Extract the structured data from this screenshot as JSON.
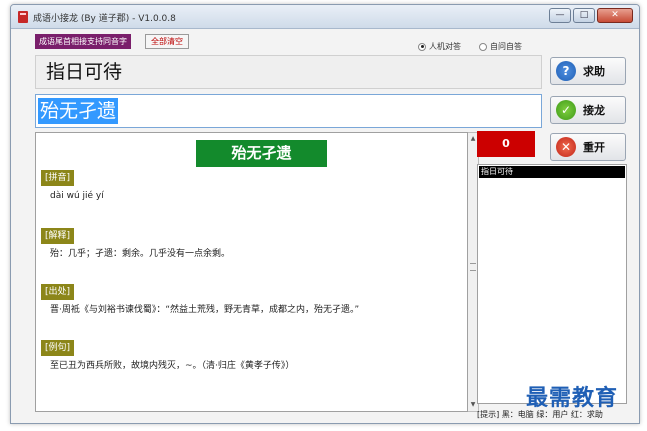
{
  "window": {
    "title": "成语小接龙 (By 道子郡) - V1.0.0.8",
    "controls": {
      "minimize": "—",
      "maximize": "□",
      "close": "✕"
    }
  },
  "toolbar": {
    "mode_tag": "成语尾首相接支持同音字",
    "clear_label": "全部清空",
    "radio_options": [
      {
        "label": "人机对答",
        "selected": true
      },
      {
        "label": "自问自答",
        "selected": false
      }
    ]
  },
  "previous_idiom": "指日可待",
  "current_input": "殆无孑遗",
  "buttons": {
    "help": "求助",
    "connect": "接龙",
    "restart": "重开"
  },
  "detail": {
    "idiom": "殆无孑遗",
    "sections": [
      {
        "label": "[拼音]",
        "text": "dài wú jié yí"
      },
      {
        "label": "[解释]",
        "text": "殆：几乎；孑遗：剩余。几乎没有一点余剩。"
      },
      {
        "label": "[出处]",
        "text": "晋·周祗《与刘裕书谏伐蜀》：“然益土荒残，野无青草，成都之内，殆无孑遗。”"
      },
      {
        "label": "[例句]",
        "text": "至已丑为西兵所败，故境内残灭，~。（清·归庄《黄孝子传》）"
      }
    ]
  },
  "score": "0",
  "history": [
    "指日可待"
  ],
  "tip": "[提示] 黑：电脑  绿：用户  红：求助",
  "watermark": "最需教育"
}
